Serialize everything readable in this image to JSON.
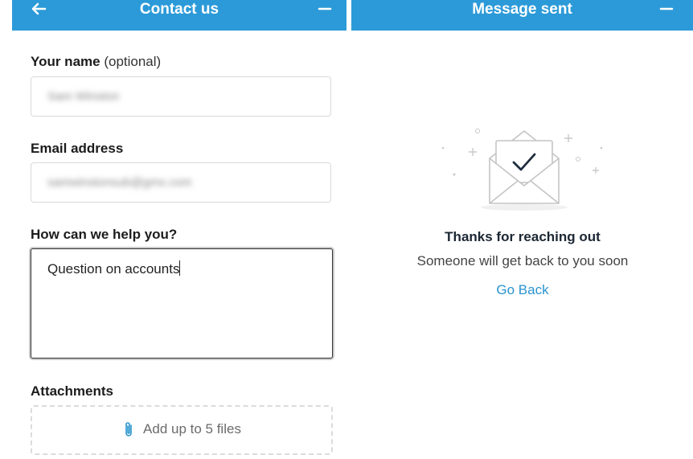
{
  "left_panel": {
    "title": "Contact us",
    "back_icon": "arrow-left-icon",
    "minimize_icon": "minus-icon"
  },
  "right_panel": {
    "title": "Message sent",
    "minimize_icon": "minus-icon"
  },
  "form": {
    "name_label": "Your name",
    "name_optional": "(optional)",
    "name_value": "Sam Winston",
    "email_label": "Email address",
    "email_value": "samwinstonsub@gmx.com",
    "help_label": "How can we help you?",
    "help_value": "Question on accounts",
    "attachments_label": "Attachments",
    "attach_text": "Add up to 5 files",
    "attach_icon": "paperclip-icon"
  },
  "confirmation": {
    "heading": "Thanks for reaching out",
    "message": "Someone will get back to you soon",
    "go_back": "Go Back",
    "illustration_icon": "envelope-check-icon"
  },
  "colors": {
    "header": "#2c9ad8",
    "link": "#2a94cf"
  }
}
